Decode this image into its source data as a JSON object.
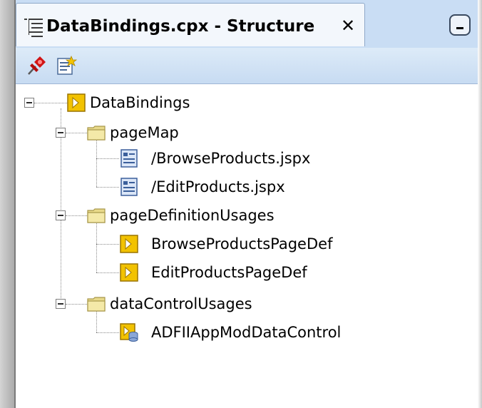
{
  "panel": {
    "title": "DataBindings.cpx - Structure",
    "close_glyph": "✕",
    "tab_icon": "structure-tree-icon",
    "minimize_icon": "minimize-icon"
  },
  "toolbar": {
    "buttons": [
      {
        "icon": "pushpin-icon"
      },
      {
        "icon": "properties-icon"
      }
    ]
  },
  "tree": {
    "root": {
      "label": "DataBindings",
      "icon": "databindings-icon"
    },
    "groups": [
      {
        "label": "pageMap",
        "icon": "folder-icon",
        "children": [
          {
            "label": "/BrowseProducts.jspx",
            "icon": "page-icon"
          },
          {
            "label": "/EditProducts.jspx",
            "icon": "page-icon"
          }
        ]
      },
      {
        "label": "pageDefinitionUsages",
        "icon": "folder-icon",
        "children": [
          {
            "label": "BrowseProductsPageDef",
            "icon": "pagedef-icon"
          },
          {
            "label": "EditProductsPageDef",
            "icon": "pagedef-icon"
          }
        ]
      },
      {
        "label": "dataControlUsages",
        "icon": "folder-icon",
        "children": [
          {
            "label": "ADFIIAppModDataControl",
            "icon": "datacontrol-icon"
          }
        ]
      }
    ]
  },
  "colors": {
    "header_bg": "#c9ddf4",
    "tab_bg": "#f3f7fc",
    "folder": "#e8d98a",
    "pagedef": "#f2c200"
  }
}
